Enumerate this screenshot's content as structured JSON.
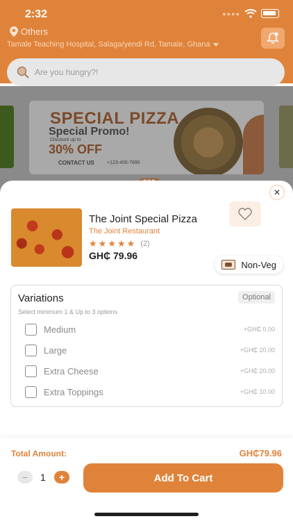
{
  "status_bar": {
    "time": "2:32",
    "signal_icon": "signal-dots-icon",
    "wifi_icon": "wifi-icon",
    "battery_icon": "battery-icon"
  },
  "header": {
    "location_icon": "location-pin-icon",
    "location_label": "Others",
    "address": "Tamale Teaching Hospital, Salaga/yendi Rd, Tamale, Ghana",
    "notification_icon": "bell-icon",
    "search_icon": "search-icon",
    "search_placeholder": "Are you hungry?!"
  },
  "banner": {
    "title": "SPECIAL PIZZA",
    "subtitle": "Special Promo!",
    "discount_text": "Discount up to",
    "discount_value": "30% OFF",
    "contact": "CONTACT US",
    "phone": "+123-456-7890",
    "page_indicator": "2/12"
  },
  "product": {
    "name": "The Joint Special Pizza",
    "restaurant": "The Joint Restaurant",
    "rating": 5,
    "rating_max": 5,
    "rating_count": "(2)",
    "price": "GH₵ 79.96",
    "favorite_icon": "heart-icon",
    "diet_tag": "Non-Veg",
    "close_icon": "close-icon"
  },
  "variations": {
    "title": "Variations",
    "badge": "Optional",
    "hint": "Select minimum 1 & Up to 3 options",
    "options": [
      {
        "name": "Medium",
        "price": "+GH₵ 0.00",
        "checked": false
      },
      {
        "name": "Large",
        "price": "+GH₵ 20.00",
        "checked": false
      },
      {
        "name": "Extra Cheese",
        "price": "+GH₵ 20.00",
        "checked": false
      },
      {
        "name": "Extra Toppings",
        "price": "+GH₵ 10.00",
        "checked": false
      }
    ]
  },
  "footer": {
    "total_label": "Total Amount:",
    "total_value": "GH₵79.96",
    "quantity": "1",
    "minus_label": "−",
    "plus_label": "+",
    "add_to_cart": "Add To Cart"
  },
  "colors": {
    "accent": "#e0833a",
    "text": "#1f1f1f",
    "muted": "#8a8a8a"
  }
}
